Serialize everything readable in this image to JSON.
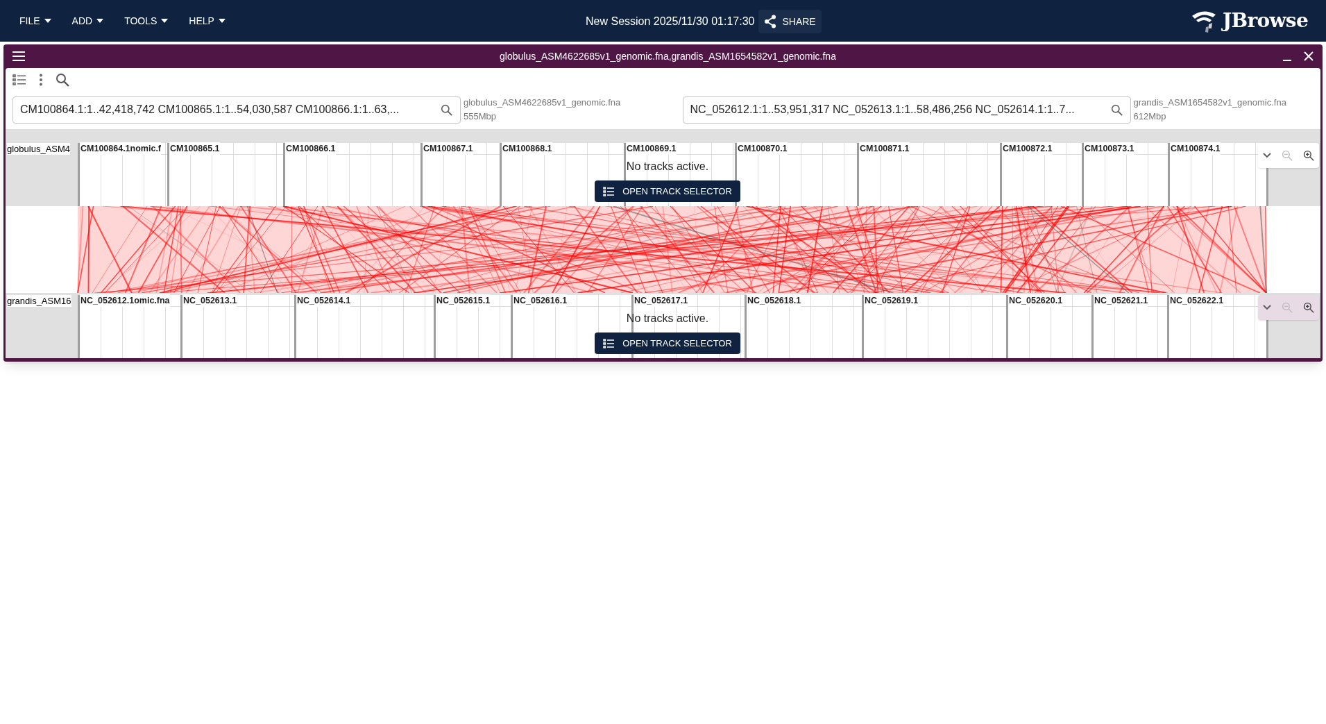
{
  "menu": [
    {
      "label": "FILE"
    },
    {
      "label": "ADD"
    },
    {
      "label": "TOOLS"
    },
    {
      "label": "HELP"
    }
  ],
  "session_title": "New Session 2025/11/30 01:17:30",
  "share_label": "SHARE",
  "logo_text": "JBrowse",
  "view": {
    "title": "globulus_ASM4622685v1_genomic.fna,grandis_ASM1654582v1_genomic.fna",
    "location_fields": [
      {
        "value": "CM100864.1:1..42,418,742 CM100865.1:1..54,030,587 CM100866.1:1..63,...",
        "assembly": "globulus_ASM4622685v1_genomic.fna",
        "size": "555Mbp"
      },
      {
        "value": "NC_052612.1:1..53,951,317 NC_052613.1:1..58,486,256 NC_052614.1:1..7...",
        "assembly": "grandis_ASM1654582v1_genomic.fna",
        "size": "612Mbp"
      }
    ],
    "tracks": [
      {
        "assembly_label": "globulus_ASM4",
        "name_tail": "nomic.f",
        "chromosomes": [
          "CM100864.1",
          "CM100865.1",
          "CM100866.1",
          "CM100867.1",
          "CM100868.1",
          "CM100869.1",
          "CM100870.1",
          "CM100871.1",
          "CM100872.1",
          "CM100873.1",
          "CM100874.1"
        ],
        "empty_message": "No tracks active.",
        "button": "OPEN TRACK SELECTOR",
        "zoom_out_disabled": true
      },
      {
        "assembly_label": "grandis_ASM16",
        "name_tail": "omic.fna",
        "chromosomes": [
          "NC_052612.1",
          "NC_052613.1",
          "NC_052614.1",
          "NC_052615.1",
          "NC_052616.1",
          "NC_052617.1",
          "NC_052618.1",
          "NC_052619.1",
          "NC_052620.1",
          "NC_052621.1",
          "NC_052622.1"
        ],
        "empty_message": "No tracks active.",
        "button": "OPEN TRACK SELECTOR",
        "zoom_out_disabled": true
      }
    ]
  }
}
